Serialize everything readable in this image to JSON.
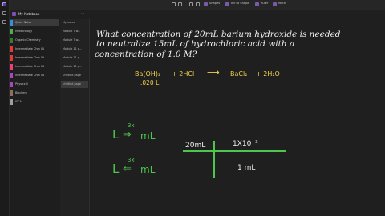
{
  "ribbon": {
    "items": [
      "Shapes",
      "Ink to Shape",
      "Ruler",
      "Math"
    ]
  },
  "notebook": {
    "title": "My Notebook"
  },
  "sections": [
    {
      "label": "Quick Notes",
      "color": "#3a8dde"
    },
    {
      "label": "Meteorology",
      "color": "#4caf50"
    },
    {
      "label": "Organic Chemistry",
      "color": "#2e7d32"
    },
    {
      "label": "Intermediate Chm 01",
      "color": "#e53935"
    },
    {
      "label": "Intermediate Chm 02",
      "color": "#e53935"
    },
    {
      "label": "Intermediate Chm 03",
      "color": "#ec407a"
    },
    {
      "label": "Intermediate Chm 04",
      "color": "#ab47bc"
    },
    {
      "label": "Physics II",
      "color": "#ab47bc"
    },
    {
      "label": "Biochem",
      "color": "#8d6e63"
    },
    {
      "label": "ISCA",
      "color": "#9e9e9e"
    }
  ],
  "pages": [
    {
      "label": "My notes"
    },
    {
      "label": "Module 7 w..."
    },
    {
      "label": "Module 7 w..."
    },
    {
      "label": "Module 11 p..."
    },
    {
      "label": "Module 11 p..."
    },
    {
      "label": "Module 11 p..."
    },
    {
      "label": "Untitled page"
    },
    {
      "label": "Untitled page"
    }
  ],
  "ink": {
    "question_line1": "What concentration of 20mL barium hydroxide is needed",
    "question_line2": "to neutralize 15mL of hydrochloric acid with a",
    "question_line3": "concentration of 1.0 M?",
    "eq_reactant1": "Ba(OH)₂",
    "eq_volume": ".020 L",
    "eq_plus1": "+ 2HCl",
    "eq_arrow": "⟶",
    "eq_product1": "BaCl₂",
    "eq_plus2": "+ 2H₂O",
    "conv1_from": "L",
    "conv1_factor": "3x",
    "conv1_arrow": "⇒",
    "conv1_to": "mL",
    "conv2_from": "L",
    "conv2_factor": "3x",
    "conv2_arrow": "⇐",
    "conv2_to": "mL",
    "table_top_left": "20mL",
    "table_top_right": "1X10⁻³",
    "table_bottom_right": "1 mL"
  }
}
